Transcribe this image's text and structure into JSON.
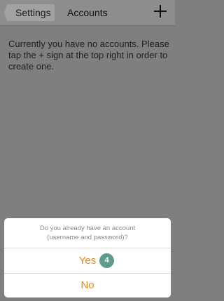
{
  "navbar": {
    "back_label": "Settings",
    "title": "Accounts",
    "add_icon": "plus-icon"
  },
  "main": {
    "message": "Currently you have no accounts. Please tap the + sign at the top right in order to create one."
  },
  "action_sheet": {
    "title_line1": "Do you already have an account",
    "title_line2": "(username and password)?",
    "yes_label": "Yes",
    "no_label": "No",
    "badge": "4"
  },
  "colors": {
    "accent": "#ea8a1a",
    "badge": "#5d9b8c",
    "overlay": "#7f7f7f"
  }
}
